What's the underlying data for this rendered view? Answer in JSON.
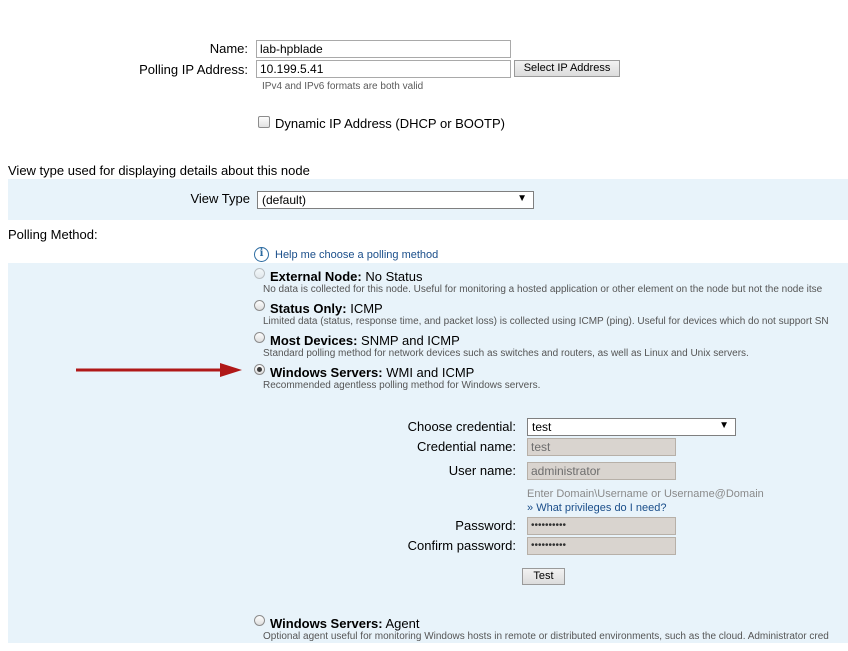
{
  "node": {
    "name_label": "Name:",
    "name_value": "lab-hpblade",
    "ip_label": "Polling IP Address:",
    "ip_value": "10.199.5.41",
    "select_ip_button": "Select IP Address",
    "ip_hint": "IPv4 and IPv6 formats are both valid",
    "dynamic_ip_label": "Dynamic IP Address (DHCP or BOOTP)"
  },
  "view": {
    "section_title": "View type used for displaying details about this node",
    "view_type_label": "View Type",
    "view_type_value": "(default)"
  },
  "polling": {
    "section_title": "Polling Method:",
    "help_link": "Help me choose a polling method",
    "options": [
      {
        "title": "External Node:",
        "subtitle": "No Status",
        "desc": "No data is collected for this node. Useful for monitoring a hosted application or other element on the node but not the node itse"
      },
      {
        "title": "Status Only:",
        "subtitle": "ICMP",
        "desc": "Limited data (status, response time, and packet loss) is collected using ICMP (ping). Useful for devices which do not support SN"
      },
      {
        "title": "Most Devices:",
        "subtitle": "SNMP and ICMP",
        "desc": "Standard polling method for network devices such as switches and routers, as well as Linux and Unix servers."
      },
      {
        "title": "Windows Servers:",
        "subtitle": "WMI and ICMP",
        "desc": "Recommended agentless polling method for Windows servers."
      },
      {
        "title": "Windows Servers:",
        "subtitle": "Agent",
        "desc": "Optional agent useful for monitoring Windows hosts in remote or distributed environments, such as the cloud. Administrator cred"
      }
    ]
  },
  "credential": {
    "choose_label": "Choose credential:",
    "choose_value": "test",
    "name_label": "Credential name:",
    "name_value": "test",
    "user_label": "User name:",
    "user_value": "administrator",
    "user_hint": "Enter Domain\\Username or Username@Domain",
    "privileges_link": "What privileges do I need?",
    "privileges_prefix": "»",
    "password_label": "Password:",
    "password_value": "••••••••••",
    "confirm_label": "Confirm password:",
    "confirm_value": "••••••••••",
    "test_button": "Test"
  },
  "colors": {
    "band": "#e8f3fa",
    "arrow": "#b01818",
    "link": "#1a4e8a"
  }
}
